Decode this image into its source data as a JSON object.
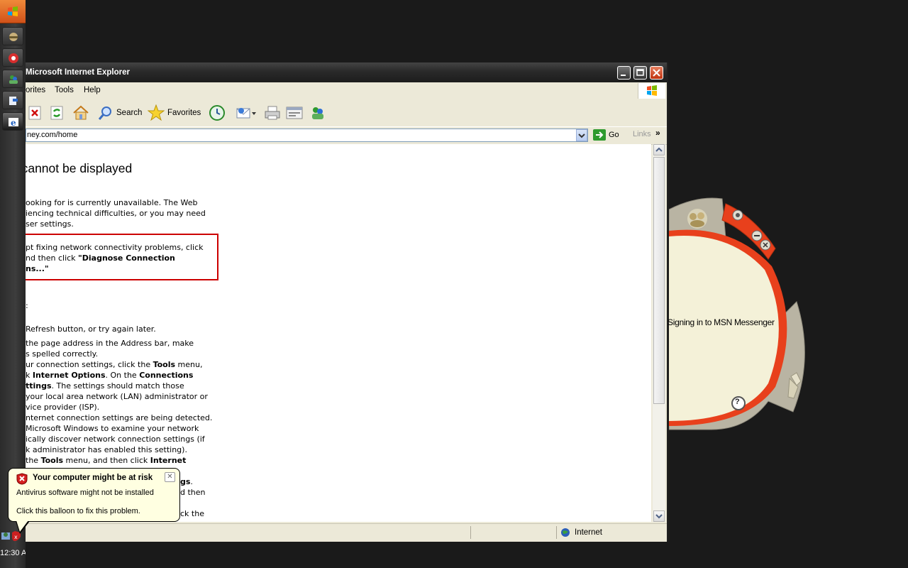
{
  "ie": {
    "title": "Microsoft Internet Explorer",
    "menu": [
      "orites",
      "Tools",
      "Help"
    ],
    "toolbar": {
      "search": "Search",
      "favorites": "Favorites"
    },
    "address": "ney.com/home",
    "go": "Go",
    "links": "Links",
    "status_zone": "Internet"
  },
  "page": {
    "title": "e cannot be displayed",
    "para1": [
      "ooking for is currently unavailable. The Web",
      "iencing technical difficulties, or you may need",
      "ser settings."
    ],
    "diag": [
      "pt fixing network connectivity problems, click",
      "nd then click ",
      "\"Diagnose Connection",
      "ns...\""
    ],
    "head2": ":",
    "lines": [
      "Refresh button, or try again later.",
      "the page address in the Address bar, make",
      "s spelled correctly.",
      "ur connection settings, click the ",
      "Tools",
      " menu,",
      "k ",
      "Internet Options",
      ". On the ",
      "Connections",
      "ttings",
      ". The settings should match those",
      "your local area network (LAN) administrator or",
      "vice provider (ISP).",
      "nternet connection settings are being detected.",
      "Microsoft Windows to examine your network",
      "ically discover network connection settings (if",
      "k administrator has enabled this setting).",
      "the ",
      "Tools",
      " menu, and then click ",
      "Internet",
      "gs",
      ".",
      "d then",
      "ck the"
    ]
  },
  "balloon": {
    "title": "Your computer might be at risk",
    "line1": "Antivirus software might not be installed",
    "line2": "Click this balloon to fix this problem.",
    "close": "✕"
  },
  "msn": {
    "status": "Signing in to MSN Messenger",
    "help": "?"
  },
  "taskbar": {
    "clock": "12:30 A"
  }
}
